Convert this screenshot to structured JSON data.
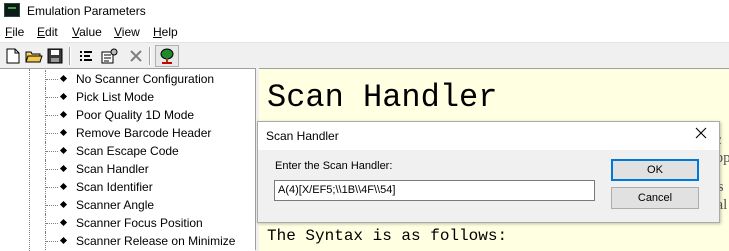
{
  "window": {
    "title": "Emulation Parameters"
  },
  "menu": [
    {
      "label": "File",
      "accel": "F",
      "rest": "ile"
    },
    {
      "label": "Edit",
      "accel": "E",
      "rest": "dit"
    },
    {
      "label": "Value",
      "accel": "V",
      "rest": "alue"
    },
    {
      "label": "View",
      "accel": "V",
      "rest": "iew"
    },
    {
      "label": "Help",
      "accel": "H",
      "rest": "elp"
    }
  ],
  "toolbar": {
    "icons": [
      "new-file-icon",
      "open-folder-icon",
      "save-icon",
      "properties-list-icon",
      "configure-icon",
      "delete-icon",
      "tree-icon"
    ]
  },
  "tree": {
    "items": [
      "No Scanner Configuration",
      "Pick List Mode",
      "Poor Quality 1D Mode",
      "Remove Barcode Header",
      "Scan Escape Code",
      "Scan Handler",
      "Scan Identifier",
      "Scanner Angle",
      "Scanner Focus Position",
      "Scanner Release on Minimize"
    ],
    "selected": "Scan Handler"
  },
  "help": {
    "title": "Scan Handler",
    "syntax": "The Syntax is as follows:",
    "fragments": [
      "sc",
      "app",
      "r s",
      "nal"
    ]
  },
  "dialog": {
    "title": "Scan Handler",
    "prompt": "Enter the Scan Handler:",
    "value": "A(4)[X/EF5;\\\\1B\\\\4F\\\\54]",
    "ok_label": "OK",
    "cancel_label": "Cancel"
  },
  "colors": {
    "help_background": "#ffffe1",
    "default_button_border": "#0078d7"
  }
}
